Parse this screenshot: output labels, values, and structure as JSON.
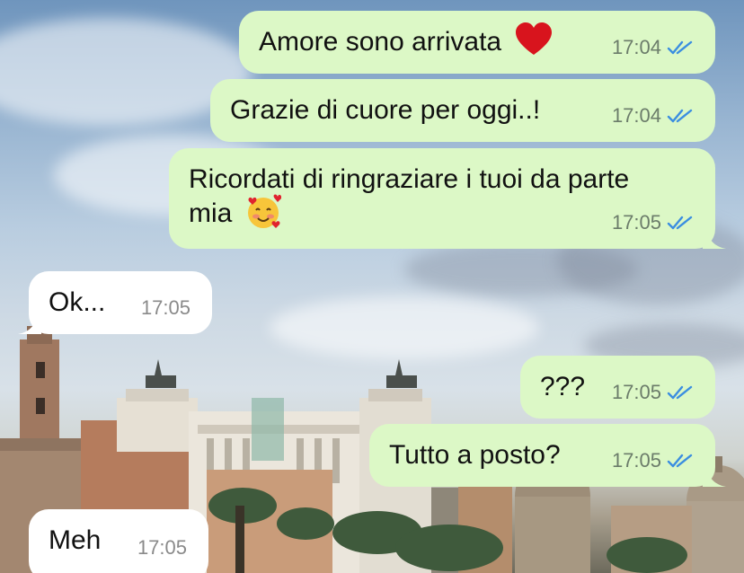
{
  "chat": {
    "messages": [
      {
        "direction": "out",
        "text": "Amore sono arrivata",
        "emoji": "red-heart",
        "time": "17:04",
        "status": "read"
      },
      {
        "direction": "out",
        "text": "Grazie di cuore per oggi..!",
        "time": "17:04",
        "status": "read"
      },
      {
        "direction": "out",
        "text_line1": "Ricordati di ringraziare i tuoi da parte",
        "text_line2": "mia",
        "emoji": "smiling-face-with-hearts",
        "time": "17:05",
        "status": "read"
      },
      {
        "direction": "in",
        "text": "Ok...",
        "time": "17:05"
      },
      {
        "direction": "out",
        "text": "???",
        "time": "17:05",
        "status": "read"
      },
      {
        "direction": "out",
        "text": "Tutto a posto?",
        "time": "17:05",
        "status": "read"
      },
      {
        "direction": "in",
        "text": "Meh",
        "time": "17:05"
      }
    ]
  },
  "colors": {
    "outgoing_bubble": "#dcf8c6",
    "incoming_bubble": "#ffffff",
    "read_ticks": "#3b8ee0"
  }
}
